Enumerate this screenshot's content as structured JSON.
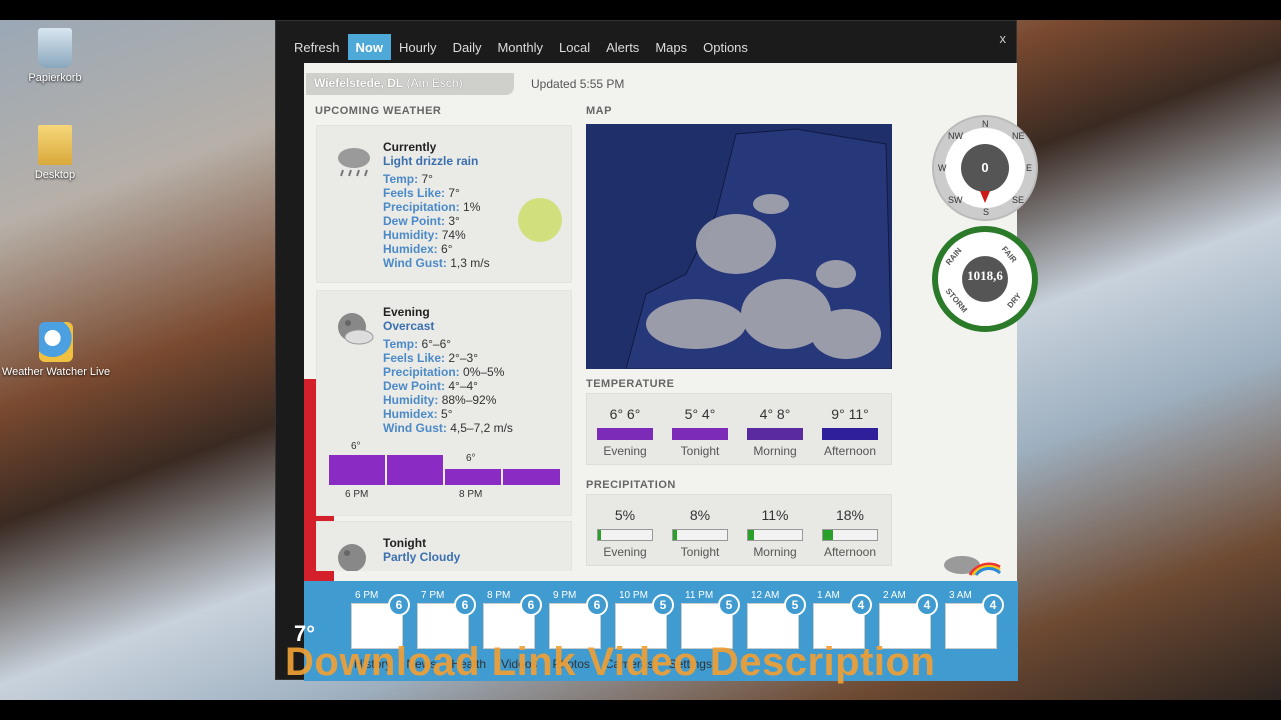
{
  "desktop": {
    "icons": [
      {
        "label": "Papierkorb",
        "icon": "recycle-bin-icon"
      },
      {
        "label": "Desktop",
        "icon": "folder-icon"
      },
      {
        "label": "Weather Watcher Live",
        "icon": "weather-app-icon"
      }
    ]
  },
  "window": {
    "menu": [
      "Refresh",
      "Now",
      "Hourly",
      "Daily",
      "Monthly",
      "Local",
      "Alerts",
      "Maps",
      "Options"
    ],
    "active_menu": "Now",
    "close_label": "x",
    "location": "Wiefelstede, DL",
    "location_sub": "(Am Esch)",
    "updated": "Updated 5:55 PM"
  },
  "upcoming": {
    "heading": "UPCOMING WEATHER",
    "cards": [
      {
        "title": "Currently",
        "condition": "Light drizzle rain",
        "icon": "drizzle-icon",
        "rows": [
          [
            "Temp:",
            "7°"
          ],
          [
            "Feels Like:",
            "7°"
          ],
          [
            "Precipitation:",
            "1%"
          ],
          [
            "Dew Point:",
            "3°"
          ],
          [
            "Humidity:",
            "74%"
          ],
          [
            "Humidex:",
            "6°"
          ],
          [
            "Wind Gust:",
            "1,3 m/s"
          ]
        ]
      },
      {
        "title": "Evening",
        "condition": "Overcast",
        "icon": "overcast-moon-icon",
        "rows": [
          [
            "Temp:",
            "6°–6°"
          ],
          [
            "Feels Like:",
            "2°–3°"
          ],
          [
            "Precipitation:",
            "0%–5%"
          ],
          [
            "Dew Point:",
            "4°–4°"
          ],
          [
            "Humidity:",
            "88%–92%"
          ],
          [
            "Humidex:",
            "5°"
          ],
          [
            "Wind Gust:",
            "4,5–7,2 m/s"
          ]
        ],
        "mini_chart": {
          "labels": [
            "6 PM",
            "8 PM"
          ],
          "top_values": [
            "6°",
            "6°"
          ]
        }
      },
      {
        "title": "Tonight",
        "condition": "Partly Cloudy",
        "icon": "partly-cloudy-moon-icon"
      }
    ]
  },
  "map": {
    "heading": "MAP"
  },
  "temperature": {
    "heading": "TEMPERATURE",
    "items": [
      {
        "value": "6° 6°",
        "label": "Evening",
        "color": "#7b2bb7"
      },
      {
        "value": "5° 4°",
        "label": "Tonight",
        "color": "#7b2bb7"
      },
      {
        "value": "4° 8°",
        "label": "Morning",
        "color": "#5a2aa0"
      },
      {
        "value": "9° 11°",
        "label": "Afternoon",
        "color": "#2f1f9a"
      }
    ]
  },
  "precipitation": {
    "heading": "PRECIPITATION",
    "items": [
      {
        "value": "5%",
        "label": "Evening",
        "fraction": 0.05
      },
      {
        "value": "8%",
        "label": "Tonight",
        "fraction": 0.08
      },
      {
        "value": "11%",
        "label": "Morning",
        "fraction": 0.11
      },
      {
        "value": "18%",
        "label": "Afternoon",
        "fraction": 0.18
      }
    ]
  },
  "gauges": {
    "compass": {
      "value": "0",
      "dirs": [
        "N",
        "NE",
        "E",
        "SE",
        "S",
        "SW",
        "W",
        "NW"
      ]
    },
    "barometer": {
      "value": "1018,6",
      "labels": [
        "RAIN",
        "FAIR",
        "STORM",
        "DRY"
      ]
    }
  },
  "hourly": [
    {
      "time": "6 PM",
      "badge": "6"
    },
    {
      "time": "7 PM",
      "badge": "6"
    },
    {
      "time": "8 PM",
      "badge": "6"
    },
    {
      "time": "9 PM",
      "badge": "6"
    },
    {
      "time": "10 PM",
      "badge": "5"
    },
    {
      "time": "11 PM",
      "badge": "5"
    },
    {
      "time": "12 AM",
      "badge": "5"
    },
    {
      "time": "1 AM",
      "badge": "4"
    },
    {
      "time": "2 AM",
      "badge": "4"
    },
    {
      "time": "3 AM",
      "badge": "4"
    }
  ],
  "current_temp": "7°",
  "bottom_tabs": [
    "History",
    "News",
    "Health",
    "Videos",
    "Photos",
    "Cameras",
    "Settings"
  ],
  "overlay_text": "Download Link Video Description"
}
